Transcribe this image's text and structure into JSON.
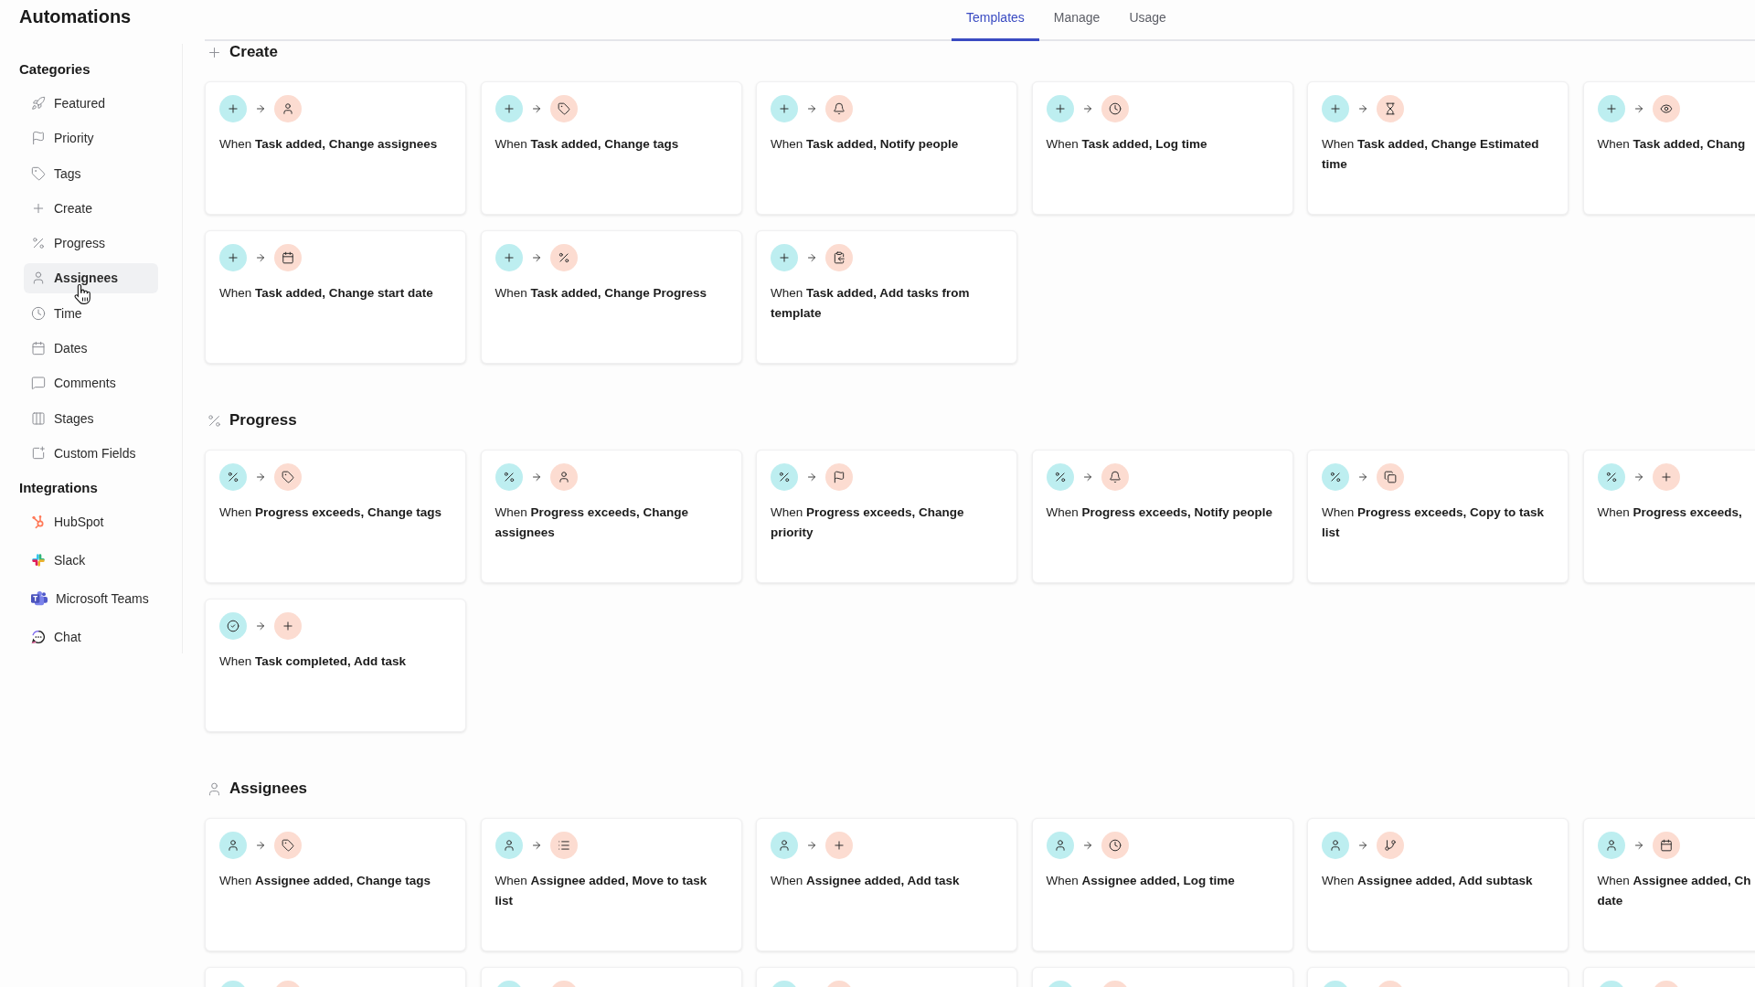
{
  "app": {
    "title": "Automations"
  },
  "tabs": [
    {
      "label": "Templates",
      "selected": true
    },
    {
      "label": "Manage",
      "selected": false
    },
    {
      "label": "Usage",
      "selected": false
    }
  ],
  "sidebar": {
    "sections": [
      {
        "heading": "Categories",
        "items": [
          {
            "label": "Featured",
            "kind": "rocket",
            "selected": false
          },
          {
            "label": "Priority",
            "kind": "flag",
            "selected": false
          },
          {
            "label": "Tags",
            "kind": "tag",
            "selected": false
          },
          {
            "label": "Create",
            "kind": "plus",
            "selected": false
          },
          {
            "label": "Progress",
            "kind": "percent",
            "selected": false
          },
          {
            "label": "Assignees",
            "kind": "person",
            "selected": true
          },
          {
            "label": "Time",
            "kind": "clock",
            "selected": false
          },
          {
            "label": "Dates",
            "kind": "calendar",
            "selected": false
          },
          {
            "label": "Comments",
            "kind": "comment",
            "selected": false
          },
          {
            "label": "Stages",
            "kind": "columns",
            "selected": false
          },
          {
            "label": "Custom Fields",
            "kind": "custom-field",
            "selected": false
          }
        ]
      },
      {
        "heading": "Integrations",
        "items": [
          {
            "label": "HubSpot",
            "kind": "hubspot",
            "selected": false
          },
          {
            "label": "Slack",
            "kind": "slack",
            "selected": false
          },
          {
            "label": "Microsoft Teams",
            "kind": "teams",
            "selected": false
          },
          {
            "label": "Chat",
            "kind": "chat",
            "selected": false
          }
        ]
      }
    ]
  },
  "sections": [
    {
      "title": "Create",
      "kind": "plus",
      "cards": [
        {
          "kind": "template",
          "trigger": {
            "kind": "plus"
          },
          "action": {
            "kind": "person"
          },
          "text": "When **Task added, Change assignees**"
        },
        {
          "kind": "template",
          "trigger": {
            "kind": "plus"
          },
          "action": {
            "kind": "tag"
          },
          "text": "When **Task added, Change tags**"
        },
        {
          "kind": "template",
          "trigger": {
            "kind": "plus"
          },
          "action": {
            "kind": "bell"
          },
          "text": "When **Task added, Notify people**"
        },
        {
          "kind": "template",
          "trigger": {
            "kind": "plus"
          },
          "action": {
            "kind": "clock"
          },
          "text": "When **Task added, Log time**"
        },
        {
          "kind": "template",
          "trigger": {
            "kind": "plus"
          },
          "action": {
            "kind": "hourglass"
          },
          "text": "When **Task added, Change Estimated time**"
        },
        {
          "kind": "template",
          "trigger": {
            "kind": "plus"
          },
          "action": {
            "kind": "eye"
          },
          "text": "When **Task added, Chang**"
        },
        {
          "kind": "template",
          "trigger": {
            "kind": "plus"
          },
          "action": {
            "kind": "calendar"
          },
          "text": "When **Task added, Change start date**"
        },
        {
          "kind": "template",
          "trigger": {
            "kind": "plus"
          },
          "action": {
            "kind": "percent"
          },
          "text": "When **Task added, Change Progress**"
        },
        {
          "kind": "template",
          "trigger": {
            "kind": "plus"
          },
          "action": {
            "kind": "clipboard"
          },
          "text": "When **Task added, Add tasks from template**"
        }
      ]
    },
    {
      "title": "Progress",
      "kind": "percent",
      "cards": [
        {
          "kind": "template",
          "trigger": {
            "kind": "percent"
          },
          "action": {
            "kind": "tag"
          },
          "text": "When **Progress exceeds, Change tags**"
        },
        {
          "kind": "template",
          "trigger": {
            "kind": "percent"
          },
          "action": {
            "kind": "person"
          },
          "text": "When **Progress exceeds, Change assignees**"
        },
        {
          "kind": "template",
          "trigger": {
            "kind": "percent"
          },
          "action": {
            "kind": "flag"
          },
          "text": "When **Progress exceeds, Change priority**"
        },
        {
          "kind": "template",
          "trigger": {
            "kind": "percent"
          },
          "action": {
            "kind": "bell"
          },
          "text": "When **Progress exceeds, Notify people**"
        },
        {
          "kind": "template",
          "trigger": {
            "kind": "percent"
          },
          "action": {
            "kind": "copy"
          },
          "text": "When **Progress exceeds, Copy to task list**"
        },
        {
          "kind": "template",
          "trigger": {
            "kind": "percent"
          },
          "action": {
            "kind": "plus"
          },
          "text": "When **Progress exceeds,**"
        },
        {
          "kind": "template",
          "trigger": {
            "kind": "check"
          },
          "action": {
            "kind": "plus"
          },
          "text": "When **Task completed, Add task**"
        }
      ]
    },
    {
      "title": "Assignees",
      "kind": "person",
      "cards": [
        {
          "kind": "template",
          "trigger": {
            "kind": "person"
          },
          "action": {
            "kind": "tag"
          },
          "text": "When **Assignee added, Change tags**"
        },
        {
          "kind": "template",
          "trigger": {
            "kind": "person"
          },
          "action": {
            "kind": "list"
          },
          "text": "When **Assignee added, Move to task list**"
        },
        {
          "kind": "template",
          "trigger": {
            "kind": "person"
          },
          "action": {
            "kind": "plus"
          },
          "text": "When **Assignee added, Add task**"
        },
        {
          "kind": "template",
          "trigger": {
            "kind": "person"
          },
          "action": {
            "kind": "clock"
          },
          "text": "When **Assignee added, Log time**"
        },
        {
          "kind": "template",
          "trigger": {
            "kind": "person"
          },
          "action": {
            "kind": "branch"
          },
          "text": "When **Assignee added, Add subtask**"
        },
        {
          "kind": "template",
          "trigger": {
            "kind": "person"
          },
          "action": {
            "kind": "calendar"
          },
          "text": "When **Assignee added, Ch**\n**date**"
        },
        {
          "kind": "partial"
        },
        {
          "kind": "partial"
        },
        {
          "kind": "partial"
        },
        {
          "kind": "partial"
        },
        {
          "kind": "partial"
        },
        {
          "kind": "partial"
        }
      ]
    }
  ]
}
